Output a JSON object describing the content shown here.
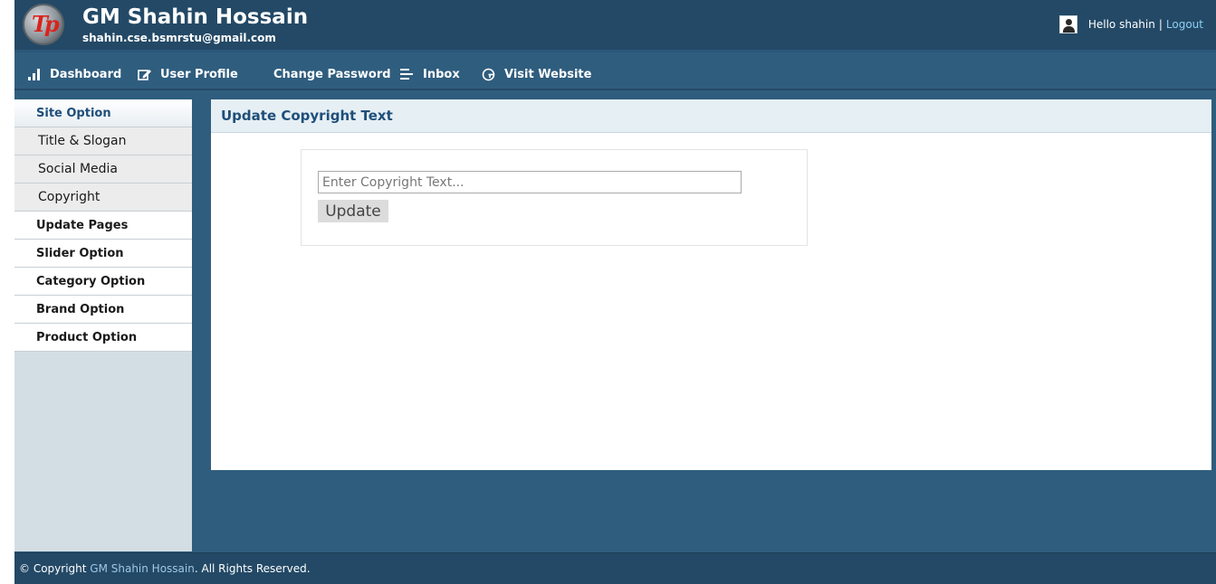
{
  "header": {
    "site_title": "GM Shahin Hossain",
    "site_email": "shahin.cse.bsmrstu@gmail.com",
    "greeting": "Hello shahin",
    "separator": "|",
    "logout_label": "Logout"
  },
  "nav": {
    "items": [
      {
        "label": "Dashboard",
        "icon": "bar-chart-icon"
      },
      {
        "label": "User Profile",
        "icon": "edit-icon"
      },
      {
        "label": "Change Password",
        "icon": ""
      },
      {
        "label": "Inbox",
        "icon": "list-icon"
      },
      {
        "label": "Visit Website",
        "icon": "globe-icon"
      }
    ]
  },
  "sidebar": {
    "site_option": "Site Option",
    "sub_items": [
      "Title & Slogan",
      "Social Media",
      "Copyright"
    ],
    "sections": [
      "Update Pages",
      "Slider Option",
      "Category Option",
      "Brand Option",
      "Product Option"
    ]
  },
  "main": {
    "panel_title": "Update Copyright Text",
    "input_placeholder": "Enter Copyright Text...",
    "input_value": "",
    "button_label": "Update"
  },
  "footer": {
    "prefix": "© Copyright",
    "owner": "GM Shahin Hossain",
    "suffix": ". All Rights Reserved."
  },
  "colors": {
    "header_bg": "#234966",
    "body_bg": "#2f5d7e",
    "panel_head_bg": "#e6eff4",
    "panel_title": "#1f4e7a",
    "logout_link": "#8fd0f5"
  }
}
